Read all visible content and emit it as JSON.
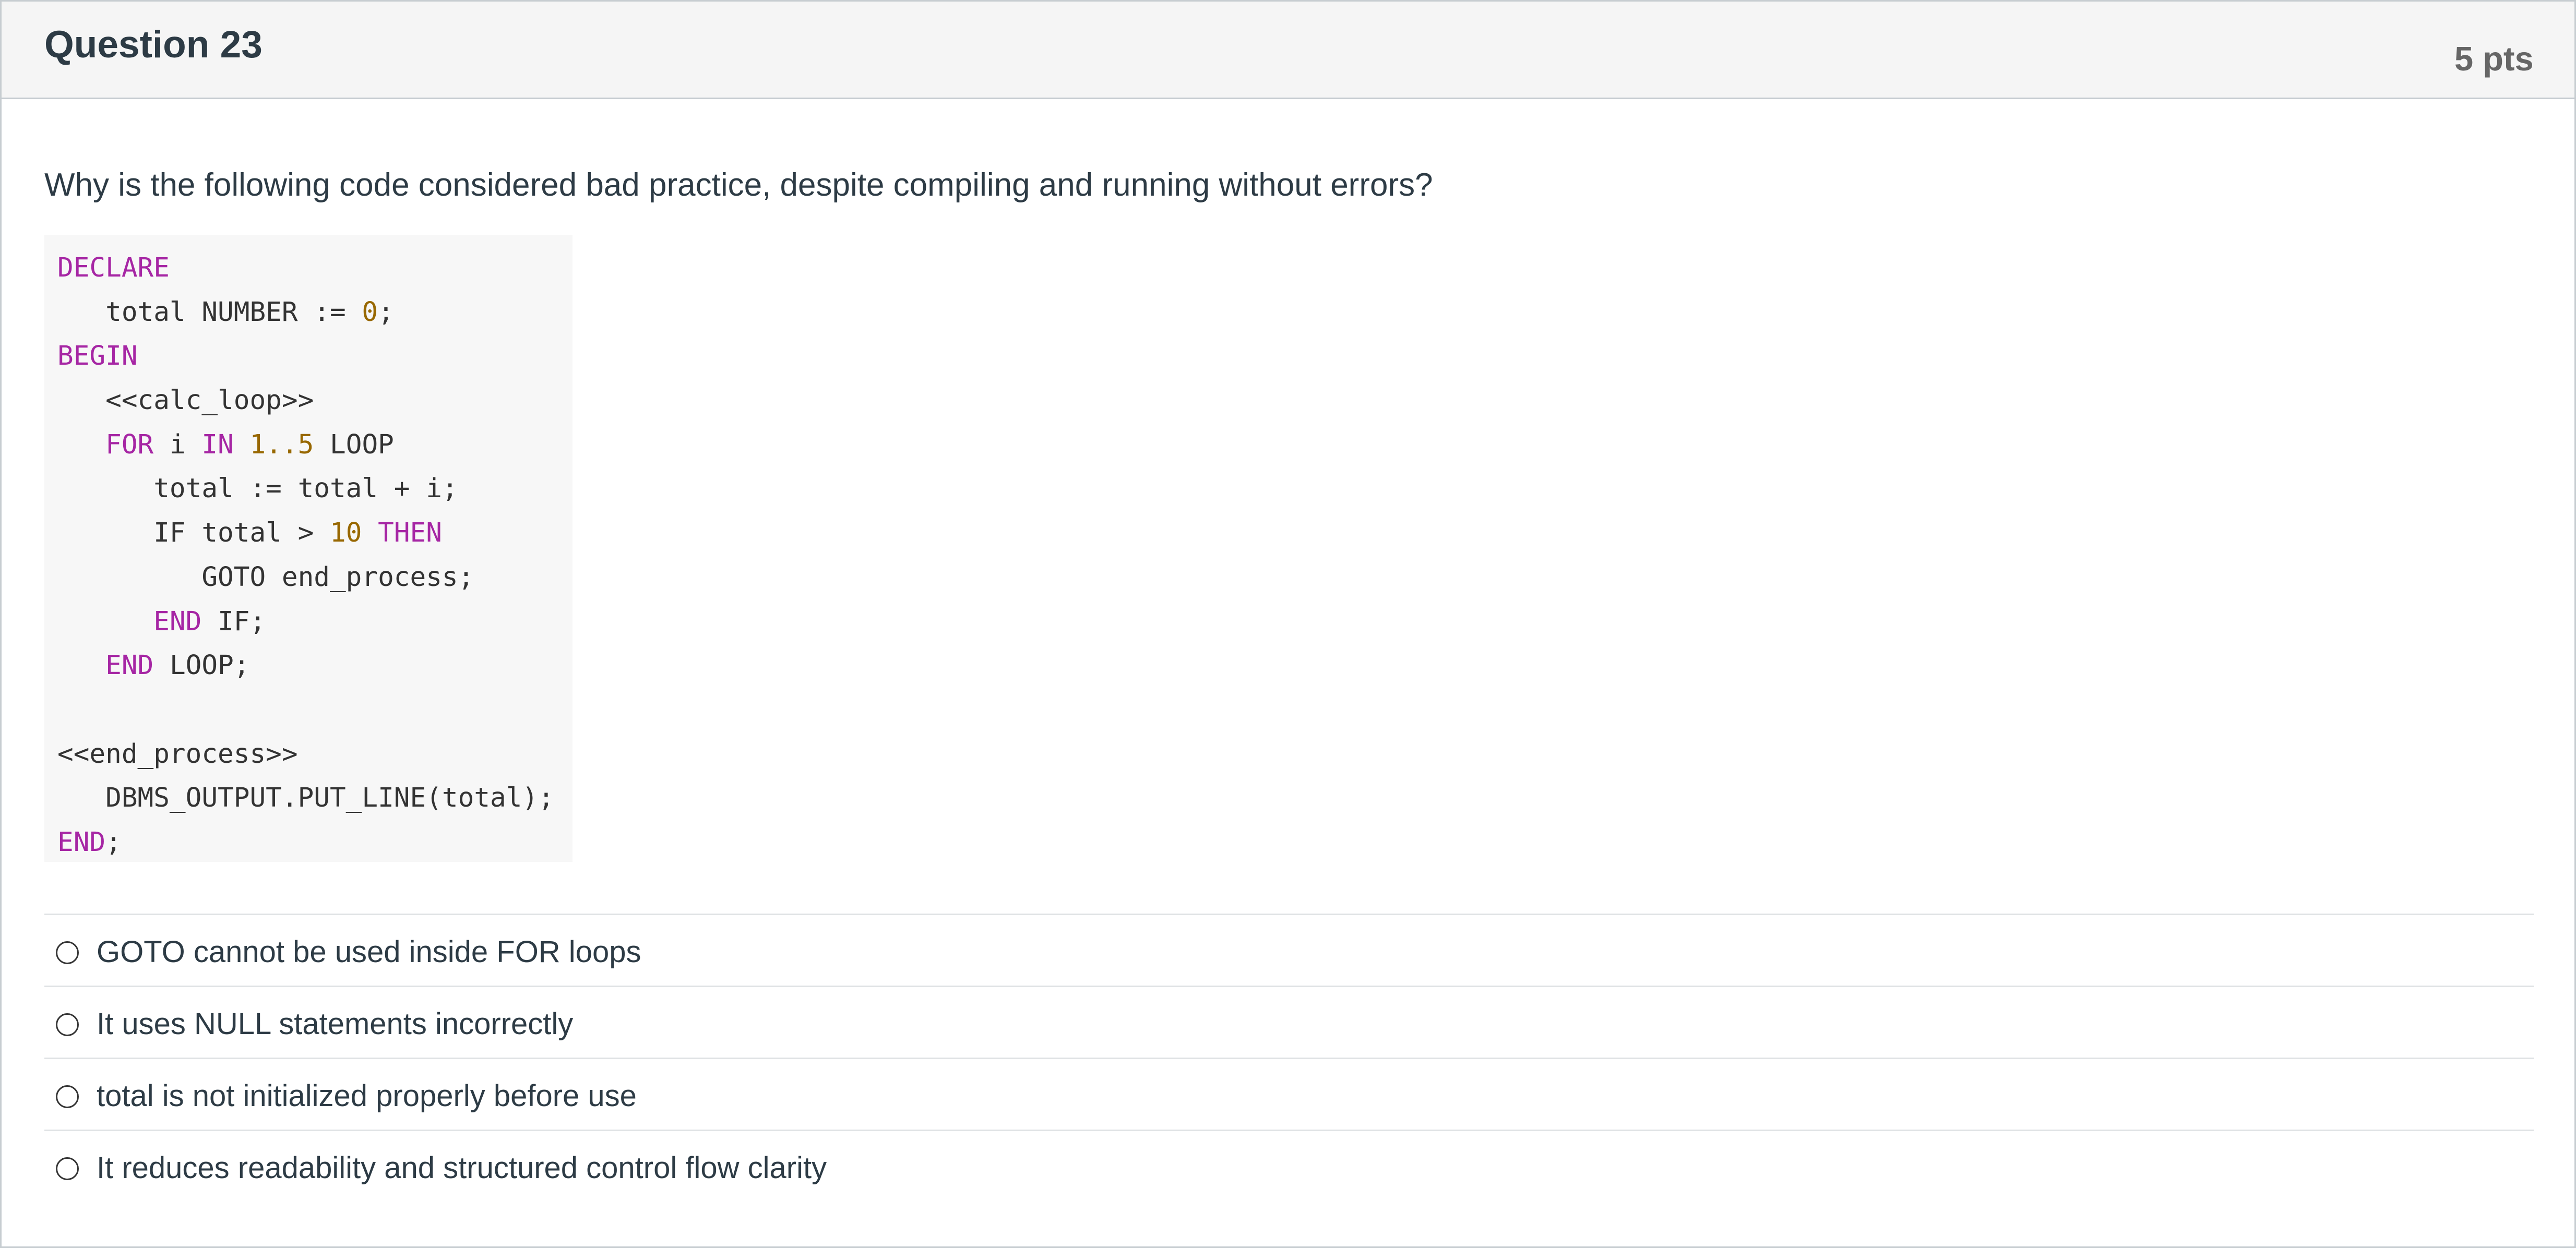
{
  "question": {
    "title": "Question 23",
    "points": "5 pts",
    "prompt": "Why is the following code considered bad practice, despite compiling and running without errors?"
  },
  "code": {
    "lines": [
      [
        {
          "t": "DECLARE",
          "c": "kw"
        }
      ],
      [
        {
          "t": "   total NUMBER := ",
          "c": ""
        },
        {
          "t": "0",
          "c": "num"
        },
        {
          "t": ";",
          "c": ""
        }
      ],
      [
        {
          "t": "BEGIN",
          "c": "kw"
        }
      ],
      [
        {
          "t": "   <<calc_loop>>",
          "c": ""
        }
      ],
      [
        {
          "t": "   ",
          "c": ""
        },
        {
          "t": "FOR",
          "c": "kw"
        },
        {
          "t": " i ",
          "c": ""
        },
        {
          "t": "IN",
          "c": "kw"
        },
        {
          "t": " ",
          "c": ""
        },
        {
          "t": "1..5",
          "c": "num"
        },
        {
          "t": " LOOP",
          "c": ""
        }
      ],
      [
        {
          "t": "      total := total + i;",
          "c": ""
        }
      ],
      [
        {
          "t": "      IF total > ",
          "c": ""
        },
        {
          "t": "10",
          "c": "num"
        },
        {
          "t": " ",
          "c": ""
        },
        {
          "t": "THEN",
          "c": "kw"
        }
      ],
      [
        {
          "t": "         GOTO end_process;",
          "c": ""
        }
      ],
      [
        {
          "t": "      ",
          "c": ""
        },
        {
          "t": "END",
          "c": "kw"
        },
        {
          "t": " IF;",
          "c": ""
        }
      ],
      [
        {
          "t": "   ",
          "c": ""
        },
        {
          "t": "END",
          "c": "kw"
        },
        {
          "t": " LOOP;",
          "c": ""
        }
      ],
      [
        {
          "t": "",
          "c": ""
        }
      ],
      [
        {
          "t": "<<end_process>>",
          "c": ""
        }
      ],
      [
        {
          "t": "   DBMS_OUTPUT.PUT_LINE(total);",
          "c": ""
        }
      ],
      [
        {
          "t": "END",
          "c": "kw"
        },
        {
          "t": ";",
          "c": ""
        }
      ]
    ]
  },
  "answers": [
    {
      "label": "GOTO cannot be used inside FOR loops",
      "selected": false
    },
    {
      "label": "It uses NULL statements incorrectly",
      "selected": false
    },
    {
      "label": "total is not initialized properly before use",
      "selected": false
    },
    {
      "label": "It reduces readability and structured control flow clarity",
      "selected": false
    }
  ]
}
